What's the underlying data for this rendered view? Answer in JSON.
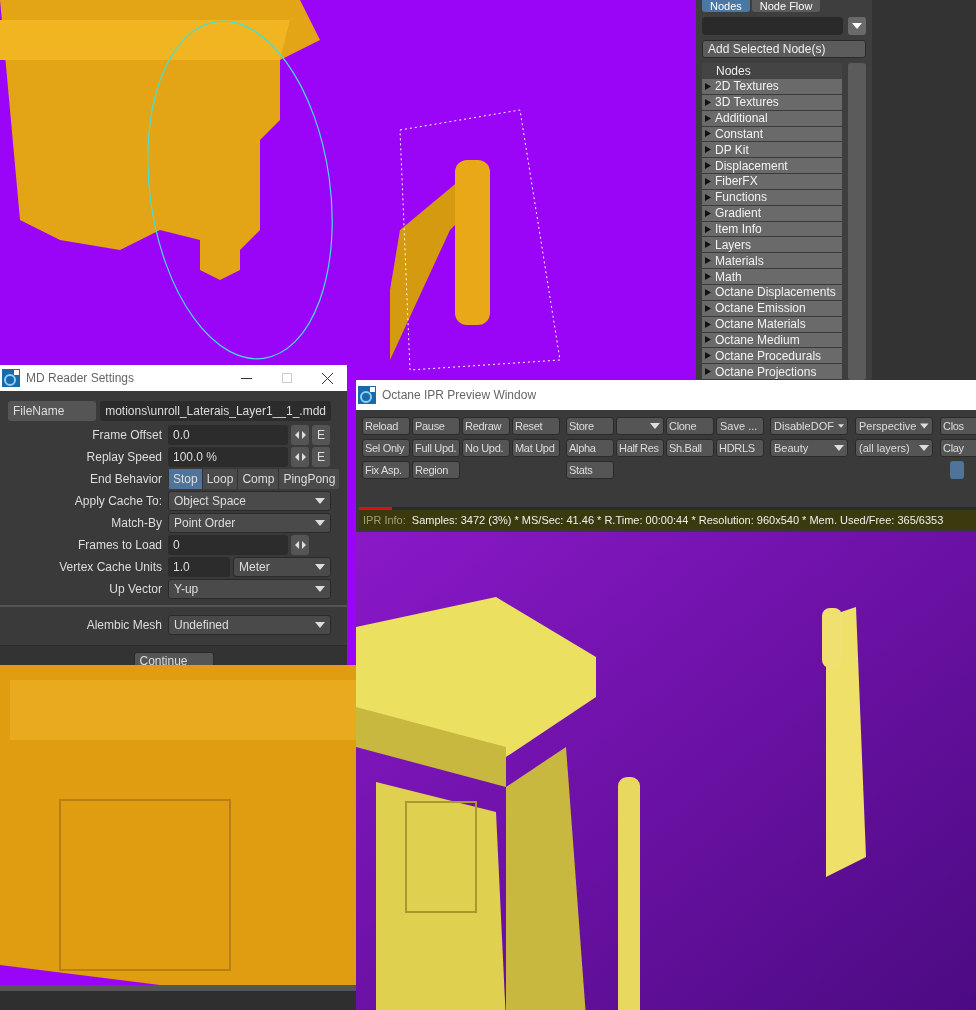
{
  "node_panel": {
    "tabs": [
      {
        "label": "Nodes",
        "selected": true
      },
      {
        "label": "Node Flow",
        "selected": false
      }
    ],
    "add_button": "Add Selected Node(s)",
    "list_header": "Nodes",
    "categories": [
      "2D Textures",
      "3D Textures",
      "Additional",
      "Constant",
      "DP Kit",
      "Displacement",
      "FiberFX",
      "Functions",
      "Gradient",
      "Item Info",
      "Layers",
      "Materials",
      "Math",
      "Octane Displacements",
      "Octane Emission",
      "Octane Materials",
      "Octane Medium",
      "Octane Procedurals",
      "Octane Projections"
    ]
  },
  "md_reader": {
    "title": "MD Reader Settings",
    "file_button": "FileName",
    "file_path": "motions\\unroll_Laterais_Layer1__1_.mdd",
    "rows": [
      {
        "kind": "number",
        "label": "Frame Offset",
        "value": "0.0",
        "envelope": "E"
      },
      {
        "kind": "number",
        "label": "Replay Speed",
        "value": "100.0 %",
        "envelope": "E"
      },
      {
        "kind": "segmented",
        "label": "End Behavior",
        "options": [
          {
            "label": "Stop",
            "selected": true
          },
          {
            "label": "Loop",
            "selected": false
          },
          {
            "label": "Comp",
            "selected": false
          },
          {
            "label": "PingPong",
            "selected": false
          }
        ]
      },
      {
        "kind": "dropdown",
        "label": "Apply Cache To:",
        "value": "Object Space"
      },
      {
        "kind": "dropdown",
        "label": "Match-By",
        "value": "Point Order"
      },
      {
        "kind": "number",
        "label": "Frames to Load",
        "value": "0"
      },
      {
        "kind": "unit",
        "label": "Vertex Cache Units",
        "value": "1.0",
        "unit": "Meter"
      },
      {
        "kind": "dropdown",
        "label": "Up Vector",
        "value": "Y-up"
      },
      {
        "kind": "divider"
      },
      {
        "kind": "dropdown",
        "label": "Alembic Mesh",
        "value": "Undefined"
      }
    ],
    "continue_button": "Continue"
  },
  "ipr_window": {
    "title": "Octane IPR Preview Window",
    "toolbar_groups": [
      {
        "rows": [
          [
            {
              "kind": "button",
              "label": "Reload"
            },
            {
              "kind": "button",
              "label": "Pause"
            },
            {
              "kind": "button",
              "label": "Redraw"
            },
            {
              "kind": "button",
              "label": "Reset"
            }
          ],
          [
            {
              "kind": "button",
              "label": "Sel Only"
            },
            {
              "kind": "button",
              "label": "Full Upd."
            },
            {
              "kind": "button",
              "label": "No Upd."
            },
            {
              "kind": "button",
              "label": "Mat Upd"
            }
          ],
          [
            {
              "kind": "button",
              "label": "Fix Asp."
            },
            {
              "kind": "button",
              "label": "Region"
            }
          ]
        ]
      },
      {
        "rows": [
          [
            {
              "kind": "button",
              "label": "Store"
            },
            {
              "kind": "dropdown"
            },
            {
              "kind": "button",
              "label": "Clone"
            },
            {
              "kind": "dropdown",
              "label": "Save ..."
            }
          ],
          [
            {
              "kind": "button",
              "label": "Alpha"
            },
            {
              "kind": "button",
              "label": "Half Res"
            },
            {
              "kind": "button",
              "label": "Sh.Ball"
            },
            {
              "kind": "button",
              "label": "HDRLS"
            }
          ],
          [
            {
              "kind": "button",
              "label": "Stats"
            }
          ]
        ]
      },
      {
        "rows": [
          [
            {
              "kind": "dropdown",
              "label": "DisableDOF"
            },
            {
              "kind": "dropdown",
              "label": "Perspective"
            },
            {
              "kind": "button",
              "label": "Clos"
            }
          ],
          [
            {
              "kind": "dropdown",
              "label": "Beauty"
            },
            {
              "kind": "dropdown",
              "label": "(all layers)"
            },
            {
              "kind": "button",
              "label": "Clay"
            }
          ],
          [
            {
              "kind": "spacer"
            },
            {
              "kind": "spacer"
            },
            {
              "kind": "toggle",
              "selected": true
            }
          ]
        ]
      }
    ],
    "progress": {
      "level": 0.05
    },
    "info_label": "IPR Info:",
    "info": "Samples: 3472 (3%)  *  MS/Sec: 41.46  *  R.Time: 00:00:44  *  Resolution: 960x540  *  Mem. Used/Free: 365/6353"
  }
}
